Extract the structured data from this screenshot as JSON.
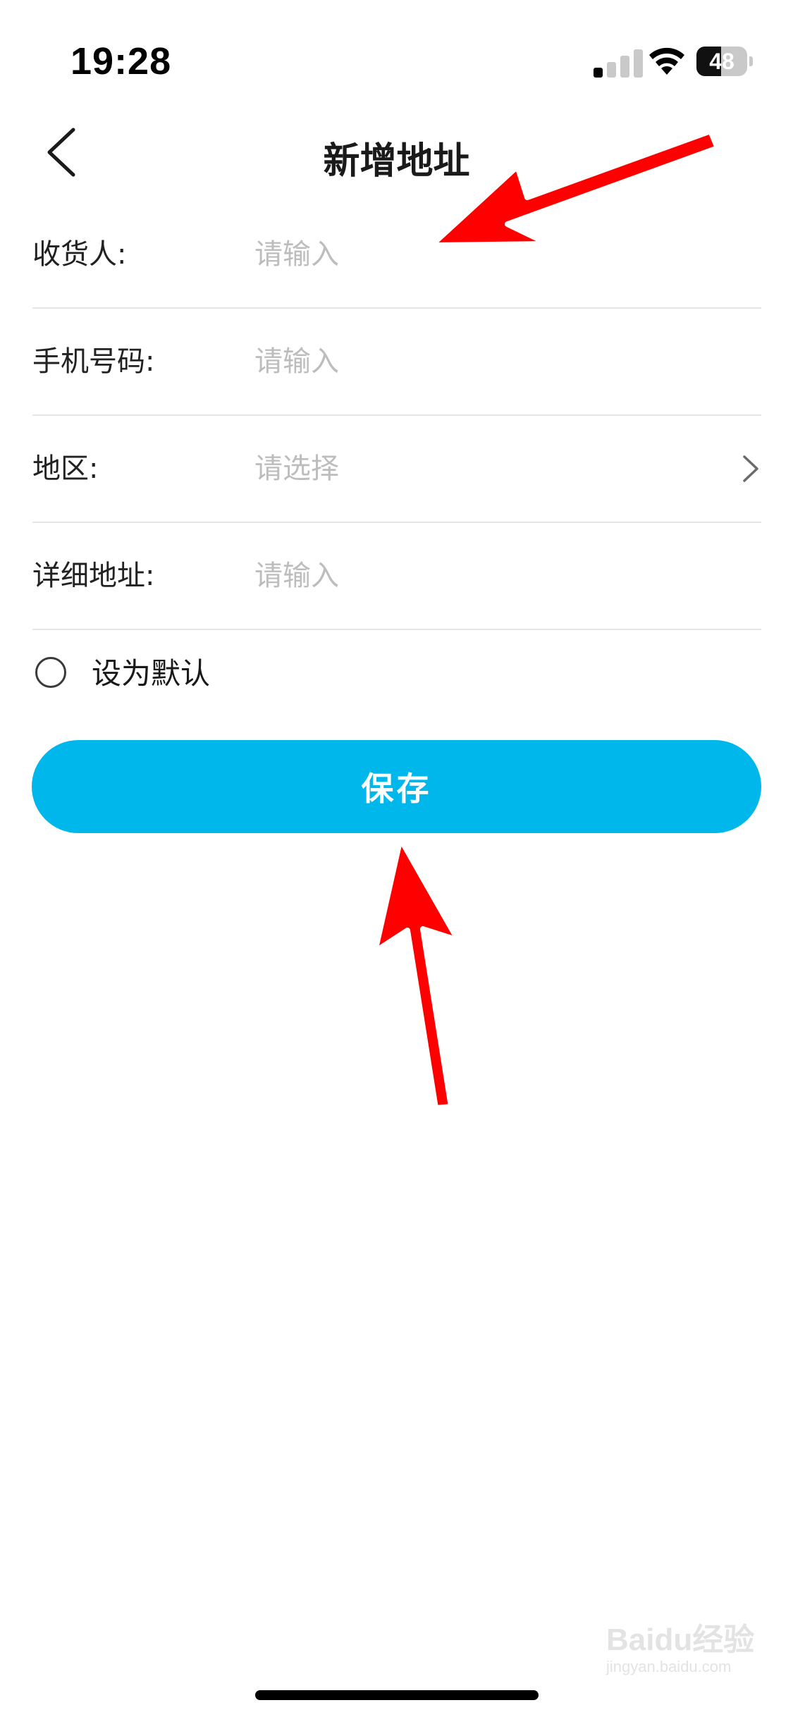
{
  "status_bar": {
    "time": "19:28",
    "battery": "48",
    "battery_level": 0.48,
    "signal_bars_active": 1,
    "signal_bars_total": 4
  },
  "nav": {
    "title": "新增地址",
    "back_icon": "chevron-left-icon"
  },
  "form": {
    "recipient": {
      "label": "收货人:",
      "placeholder": "请输入",
      "value": ""
    },
    "phone": {
      "label": "手机号码:",
      "placeholder": "请输入",
      "value": ""
    },
    "region": {
      "label": "地区:",
      "placeholder": "请选择",
      "icon": "chevron-right-icon"
    },
    "detail": {
      "label": "详细地址:",
      "placeholder": "请输入",
      "value": ""
    }
  },
  "default_option": {
    "label": "设为默认",
    "checked": false
  },
  "save_button": {
    "label": "保存"
  },
  "watermark": {
    "text": "Baidu经验",
    "sub": "jingyan.baidu.com"
  },
  "colors": {
    "accent": "#00b7ec",
    "annotation_arrow": "#ff0000",
    "placeholder": "#bdbdbd",
    "divider": "#e6e6e6"
  }
}
